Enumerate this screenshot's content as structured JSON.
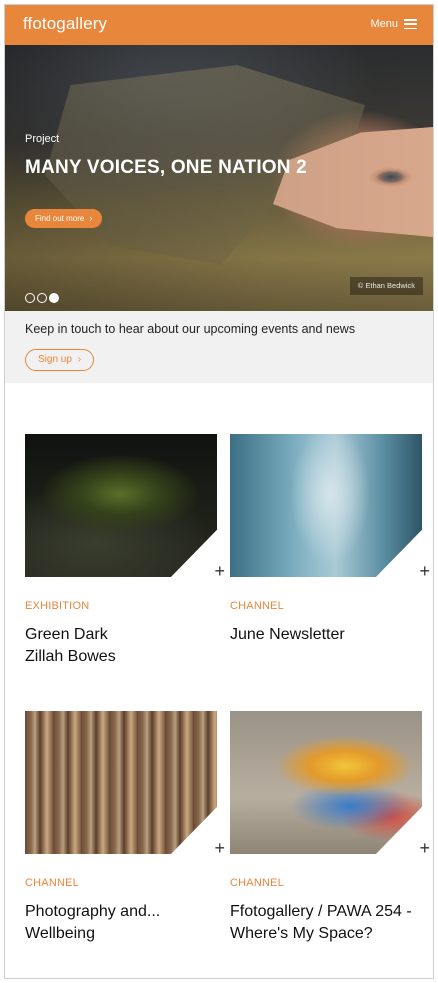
{
  "header": {
    "logo": "ffotogallery",
    "menu_label": "Menu"
  },
  "hero": {
    "kicker": "Project",
    "title": "MANY VOICES, ONE NATION 2",
    "button_label": "Find out more",
    "credit": "© Ethan Bedwick",
    "slides_total": 3,
    "active_slide": 3
  },
  "newsletter": {
    "text": "Keep in touch to hear about our upcoming events and news",
    "button_label": "Sign up"
  },
  "cards": [
    {
      "category": "EXHIBITION",
      "title": "Green Dark",
      "subtitle": "Zillah Bowes"
    },
    {
      "category": "CHANNEL",
      "title": "June Newsletter"
    },
    {
      "category": "CHANNEL",
      "title": "Photography and... Wellbeing"
    },
    {
      "category": "CHANNEL",
      "title": "Ffotogallery / PAWA 254 - Where's My Space?"
    }
  ],
  "colors": {
    "accent": "#e8863c",
    "strip_bg": "#f1f1f1"
  },
  "icons": {
    "menu": "hamburger-icon",
    "chevron": "chevron-right-icon",
    "expand": "plus-icon"
  }
}
